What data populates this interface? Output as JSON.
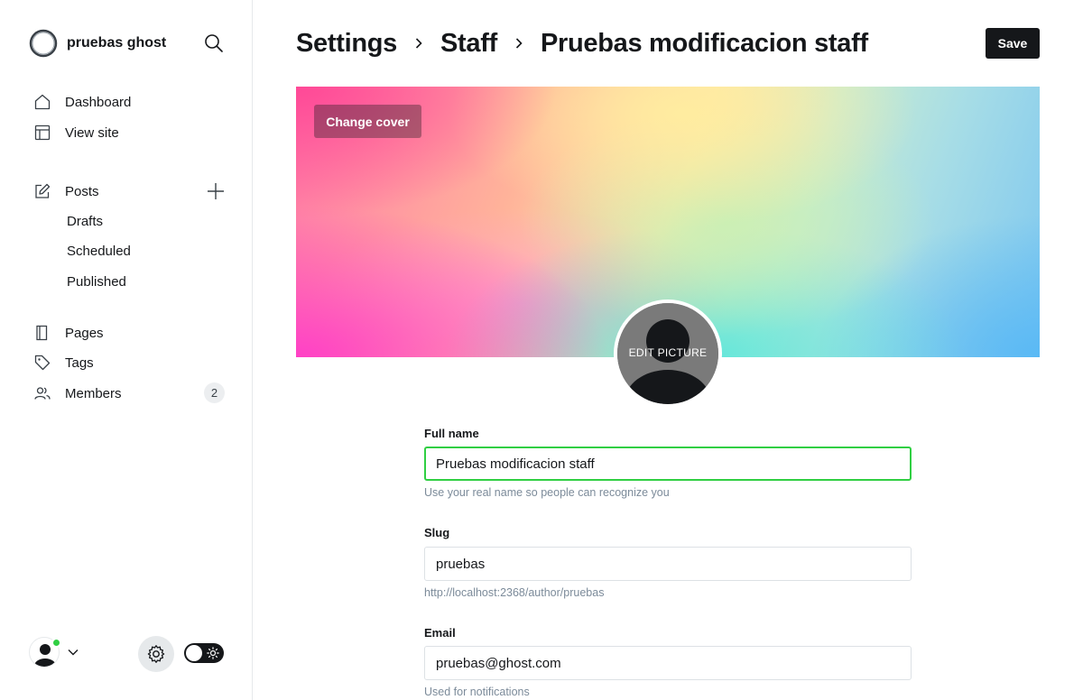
{
  "sidebar": {
    "site_name": "pruebas ghost",
    "nav": {
      "dashboard": "Dashboard",
      "view_site": "View site",
      "posts": "Posts",
      "drafts": "Drafts",
      "scheduled": "Scheduled",
      "published": "Published",
      "pages": "Pages",
      "tags": "Tags",
      "members": "Members",
      "members_count": "2"
    },
    "icons": [
      "search-icon",
      "home-icon",
      "view-site-icon",
      "posts-icon",
      "plus-icon",
      "pages-icon",
      "tags-icon",
      "members-icon",
      "chevron-down-icon",
      "gear-icon",
      "sun-icon"
    ],
    "online_color": "#30cf43"
  },
  "header": {
    "crumbs": [
      "Settings",
      "Staff",
      "Pruebas modificacion staff"
    ],
    "save_label": "Save"
  },
  "cover": {
    "change_label": "Change cover"
  },
  "profile": {
    "edit_picture_label": "EDIT PICTURE"
  },
  "form": {
    "full_name": {
      "label": "Full name",
      "value": "Pruebas modificacion staff",
      "help": "Use your real name so people can recognize you"
    },
    "slug": {
      "label": "Slug",
      "value": "pruebas",
      "help": "http://localhost:2368/author/pruebas"
    },
    "email": {
      "label": "Email",
      "value": "pruebas@ghost.com",
      "help": "Used for notifications"
    }
  },
  "colors": {
    "accent_green": "#30cf43",
    "primary_dark": "#15171a"
  }
}
